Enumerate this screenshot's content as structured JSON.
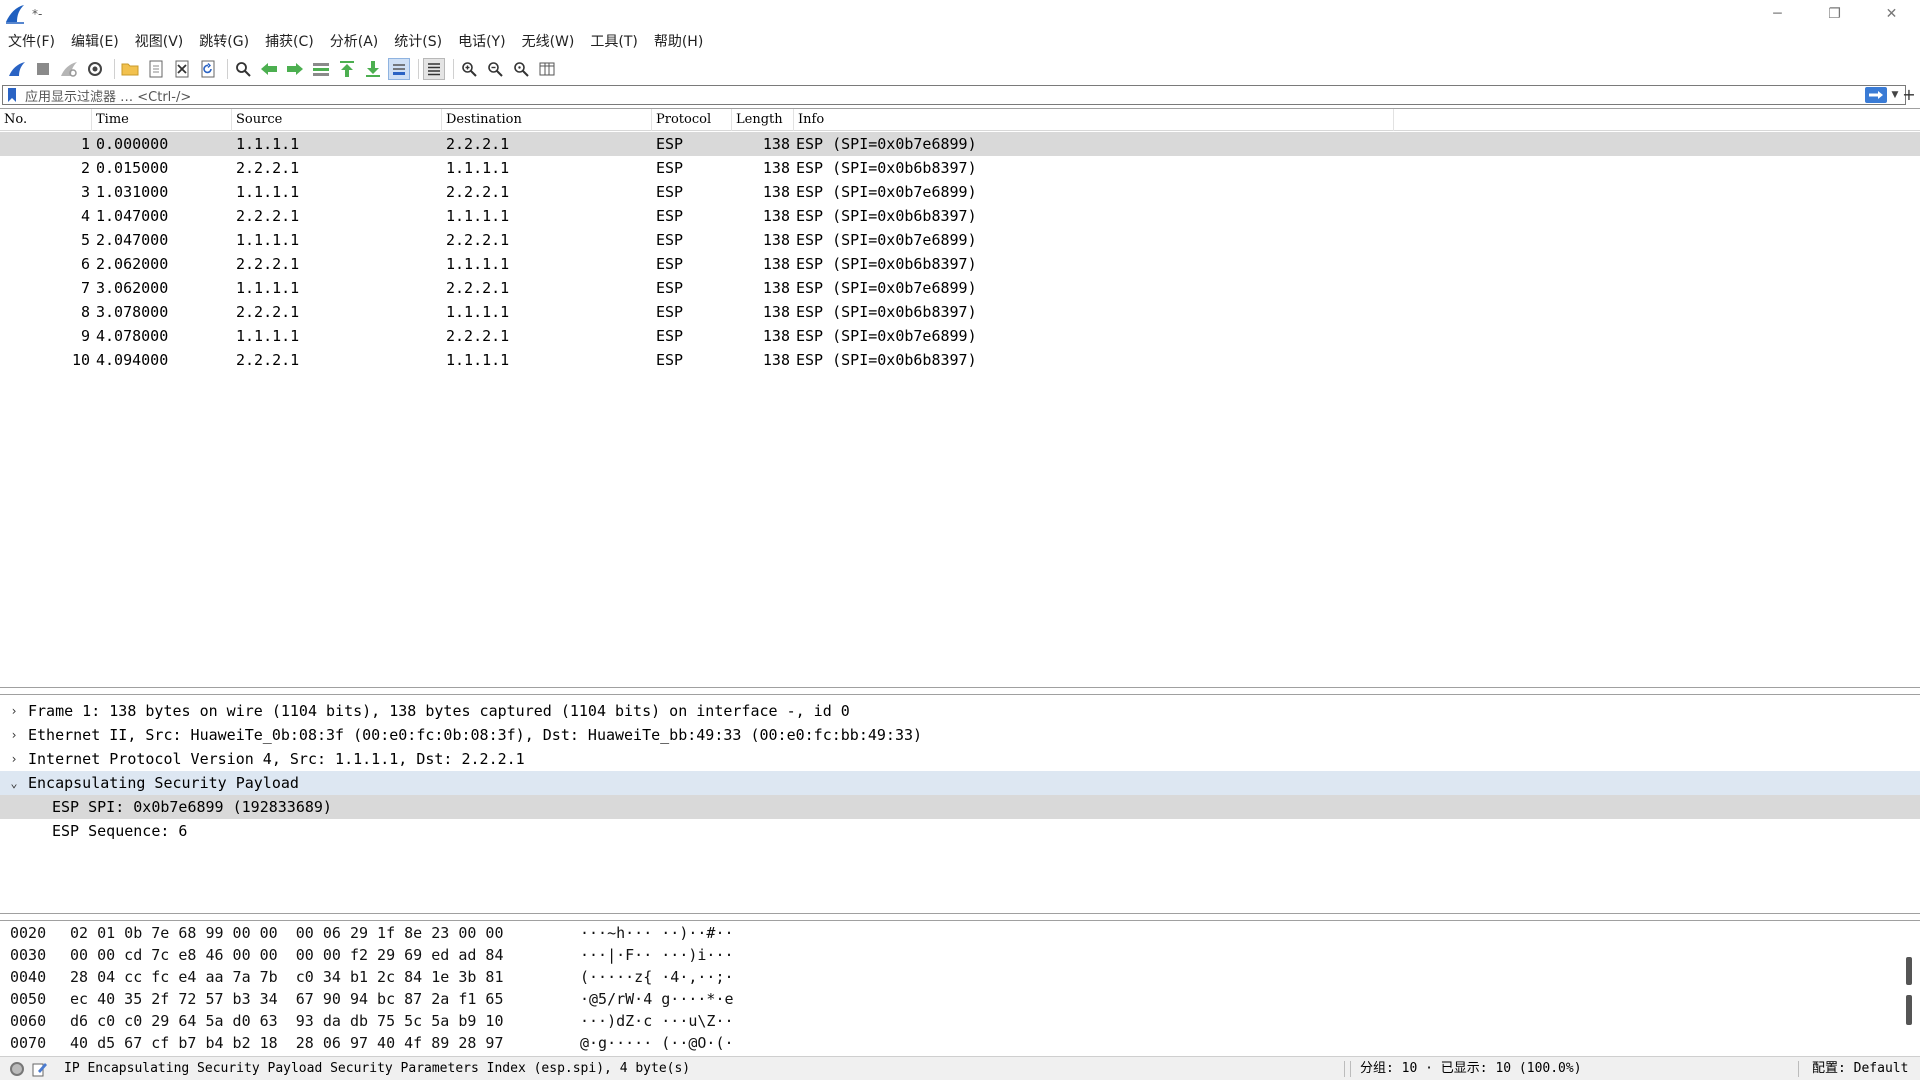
{
  "window": {
    "title": "*-",
    "minimize": "─",
    "restore": "❐",
    "close": "✕"
  },
  "menu": [
    {
      "label": "文件(F)",
      "name": "menu-file"
    },
    {
      "label": "编辑(E)",
      "name": "menu-edit"
    },
    {
      "label": "视图(V)",
      "name": "menu-view"
    },
    {
      "label": "跳转(G)",
      "name": "menu-go"
    },
    {
      "label": "捕获(C)",
      "name": "menu-capture"
    },
    {
      "label": "分析(A)",
      "name": "menu-analyze"
    },
    {
      "label": "统计(S)",
      "name": "menu-statistics"
    },
    {
      "label": "电话(Y)",
      "name": "menu-telephony"
    },
    {
      "label": "无线(W)",
      "name": "menu-wireless"
    },
    {
      "label": "工具(T)",
      "name": "menu-tools"
    },
    {
      "label": "帮助(H)",
      "name": "menu-help"
    }
  ],
  "filter": {
    "placeholder": "应用显示过滤器 … <Ctrl-/>",
    "plus": "+"
  },
  "packet_list": {
    "columns": [
      "No.",
      "Time",
      "Source",
      "Destination",
      "Protocol",
      "Length",
      "Info"
    ],
    "rows": [
      {
        "no": "1",
        "time": "0.000000",
        "source": "1.1.1.1",
        "destination": "2.2.2.1",
        "protocol": "ESP",
        "length": "138",
        "info": "ESP (SPI=0x0b7e6899)"
      },
      {
        "no": "2",
        "time": "0.015000",
        "source": "2.2.2.1",
        "destination": "1.1.1.1",
        "protocol": "ESP",
        "length": "138",
        "info": "ESP (SPI=0x0b6b8397)"
      },
      {
        "no": "3",
        "time": "1.031000",
        "source": "1.1.1.1",
        "destination": "2.2.2.1",
        "protocol": "ESP",
        "length": "138",
        "info": "ESP (SPI=0x0b7e6899)"
      },
      {
        "no": "4",
        "time": "1.047000",
        "source": "2.2.2.1",
        "destination": "1.1.1.1",
        "protocol": "ESP",
        "length": "138",
        "info": "ESP (SPI=0x0b6b8397)"
      },
      {
        "no": "5",
        "time": "2.047000",
        "source": "1.1.1.1",
        "destination": "2.2.2.1",
        "protocol": "ESP",
        "length": "138",
        "info": "ESP (SPI=0x0b7e6899)"
      },
      {
        "no": "6",
        "time": "2.062000",
        "source": "2.2.2.1",
        "destination": "1.1.1.1",
        "protocol": "ESP",
        "length": "138",
        "info": "ESP (SPI=0x0b6b8397)"
      },
      {
        "no": "7",
        "time": "3.062000",
        "source": "1.1.1.1",
        "destination": "2.2.2.1",
        "protocol": "ESP",
        "length": "138",
        "info": "ESP (SPI=0x0b7e6899)"
      },
      {
        "no": "8",
        "time": "3.078000",
        "source": "2.2.2.1",
        "destination": "1.1.1.1",
        "protocol": "ESP",
        "length": "138",
        "info": "ESP (SPI=0x0b6b8397)"
      },
      {
        "no": "9",
        "time": "4.078000",
        "source": "1.1.1.1",
        "destination": "2.2.2.1",
        "protocol": "ESP",
        "length": "138",
        "info": "ESP (SPI=0x0b7e6899)"
      },
      {
        "no": "10",
        "time": "4.094000",
        "source": "2.2.2.1",
        "destination": "1.1.1.1",
        "protocol": "ESP",
        "length": "138",
        "info": "ESP (SPI=0x0b6b8397)"
      }
    ]
  },
  "details": [
    {
      "arrow": "›",
      "text": "Frame 1: 138 bytes on wire (1104 bits), 138 bytes captured (1104 bits) on interface -, id 0"
    },
    {
      "arrow": "›",
      "text": "Ethernet II, Src: HuaweiTe_0b:08:3f (00:e0:fc:0b:08:3f), Dst: HuaweiTe_bb:49:33 (00:e0:fc:bb:49:33)"
    },
    {
      "arrow": "›",
      "text": "Internet Protocol Version 4, Src: 1.1.1.1, Dst: 2.2.2.1"
    },
    {
      "arrow": "⌄",
      "text": "Encapsulating Security Payload"
    },
    {
      "arrow": "",
      "text": "ESP SPI: 0x0b7e6899 (192833689)"
    },
    {
      "arrow": "",
      "text": "ESP Sequence: 6"
    }
  ],
  "bytes": [
    {
      "offset": "0020",
      "hex": "02 01 0b 7e 68 99 00 00  00 06 29 1f 8e 23 00 00",
      "ascii": "···~h··· ··)··#··"
    },
    {
      "offset": "0030",
      "hex": "00 00 cd 7c e8 46 00 00  00 00 f2 29 69 ed ad 84",
      "ascii": "···|·F·· ···)i···"
    },
    {
      "offset": "0040",
      "hex": "28 04 cc fc e4 aa 7a 7b  c0 34 b1 2c 84 1e 3b 81",
      "ascii": "(·····z{ ·4·,··;·"
    },
    {
      "offset": "0050",
      "hex": "ec 40 35 2f 72 57 b3 34  67 90 94 bc 87 2a f1 65",
      "ascii": "·@5/rW·4 g····*·e"
    },
    {
      "offset": "0060",
      "hex": "d6 c0 c0 29 64 5a d0 63  93 da db 75 5c 5a b9 10",
      "ascii": "···)dZ·c ···u\\Z··"
    },
    {
      "offset": "0070",
      "hex": "40 d5 67 cf b7 b4 b2 18  28 06 97 40 4f 89 28 97",
      "ascii": "@·g····· (··@O·(·"
    }
  ],
  "status": {
    "field_text": "IP Encapsulating Security Payload Security Parameters Index (esp.spi), 4 byte(s)",
    "stats_text": "分组: 10 · 已显示: 10 (100.0%)",
    "profile_text": "配置: Default"
  },
  "colors": {
    "selected_row": "#d9d9d9",
    "expanded_row": "#dde7f2",
    "accent": "#3a7bd5"
  }
}
